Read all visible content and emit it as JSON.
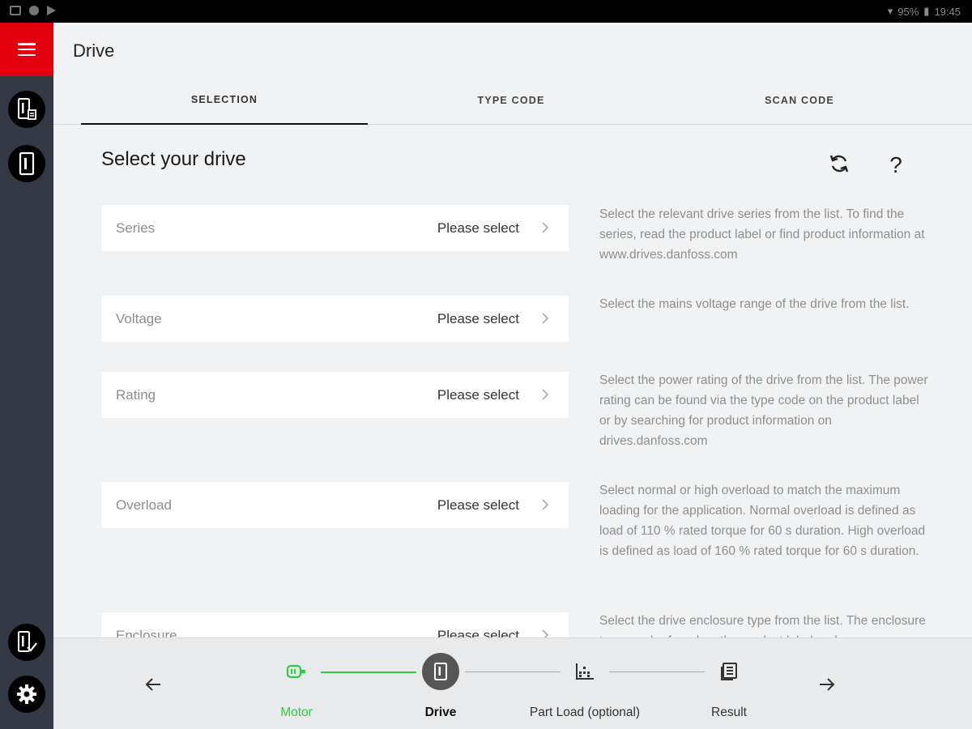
{
  "status_bar": {
    "battery": "95%",
    "time": "19:45"
  },
  "header": {
    "title": "Drive"
  },
  "tabs": [
    {
      "label": "SELECTION",
      "active": true
    },
    {
      "label": "TYPE CODE",
      "active": false
    },
    {
      "label": "SCAN CODE",
      "active": false
    }
  ],
  "content": {
    "title": "Select your drive",
    "refresh_icon": "refresh-icon",
    "help_icon": "question-icon"
  },
  "fields": [
    {
      "label": "Series",
      "value": "Please select",
      "help": "Select the relevant drive series from the list. To find the series, read the product label or find product information at www.drives.danfoss.com"
    },
    {
      "label": "Voltage",
      "value": "Please select",
      "help": "Select the mains voltage range of the drive from the list."
    },
    {
      "label": "Rating",
      "value": "Please select",
      "help": "Select the power rating of the drive from the list. The power rating can be found via the type code on the product label or by searching for product information on drives.danfoss.com"
    },
    {
      "label": "Overload",
      "value": "Please select",
      "help": "Select normal or high overload to match the maximum loading for the application. Normal overload is defined as load of 110 % rated torque for 60 s duration. High overload is defined as load of 160 % rated torque for 60 s duration."
    },
    {
      "label": "Enclosure",
      "value": "Please select",
      "help": "Select the drive enclosure type from the list. The enclosure type can be found on the product label and"
    }
  ],
  "steps": [
    {
      "label": "Motor",
      "state": "completed",
      "icon": "motor-icon"
    },
    {
      "label": "Drive",
      "state": "active",
      "icon": "drive-icon"
    },
    {
      "label": "Part Load (optional)",
      "state": "pending",
      "icon": "chart-icon"
    },
    {
      "label": "Result",
      "state": "pending",
      "icon": "result-icon"
    }
  ],
  "colors": {
    "brand_red": "#e2000f",
    "rail": "#333a45",
    "step_done": "#2ecc40"
  }
}
